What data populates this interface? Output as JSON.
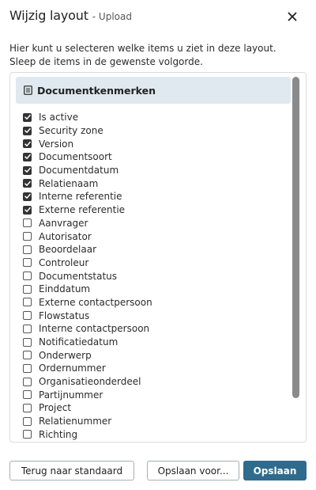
{
  "dialog": {
    "title": "Wijzig layout",
    "subtitle": "- Upload",
    "intro": "Hier kunt u selecteren welke items u ziet in deze layout. Sleep de items in de gewenste volgorde."
  },
  "section": {
    "title": "Documentkenmerken"
  },
  "items": [
    {
      "label": "Is active",
      "checked": true
    },
    {
      "label": "Security zone",
      "checked": true
    },
    {
      "label": "Version",
      "checked": true
    },
    {
      "label": "Documentsoort",
      "checked": true
    },
    {
      "label": "Documentdatum",
      "checked": true
    },
    {
      "label": "Relatienaam",
      "checked": true
    },
    {
      "label": "Interne referentie",
      "checked": true
    },
    {
      "label": "Externe referentie",
      "checked": true
    },
    {
      "label": "Aanvrager",
      "checked": false
    },
    {
      "label": "Autorisator",
      "checked": false
    },
    {
      "label": "Beoordelaar",
      "checked": false
    },
    {
      "label": "Controleur",
      "checked": false
    },
    {
      "label": "Documentstatus",
      "checked": false
    },
    {
      "label": "Einddatum",
      "checked": false
    },
    {
      "label": "Externe contactpersoon",
      "checked": false
    },
    {
      "label": "Flowstatus",
      "checked": false
    },
    {
      "label": "Interne contactpersoon",
      "checked": false
    },
    {
      "label": "Notificatiedatum",
      "checked": false
    },
    {
      "label": "Onderwerp",
      "checked": false
    },
    {
      "label": "Ordernummer",
      "checked": false
    },
    {
      "label": "Organisatieonderdeel",
      "checked": false
    },
    {
      "label": "Partijnummer",
      "checked": false
    },
    {
      "label": "Project",
      "checked": false
    },
    {
      "label": "Relatienummer",
      "checked": false
    },
    {
      "label": "Richting",
      "checked": false
    }
  ],
  "footer": {
    "reset_label": "Terug naar standaard",
    "save_as_label": "Opslaan voor...",
    "save_label": "Opslaan"
  },
  "colors": {
    "primary": "#2e6b8d",
    "section_bg": "#dfe9ef",
    "scrollbar": "#8a8a8a"
  },
  "icons": {
    "close": "close-icon",
    "section": "document-icon",
    "check": "check-icon"
  }
}
